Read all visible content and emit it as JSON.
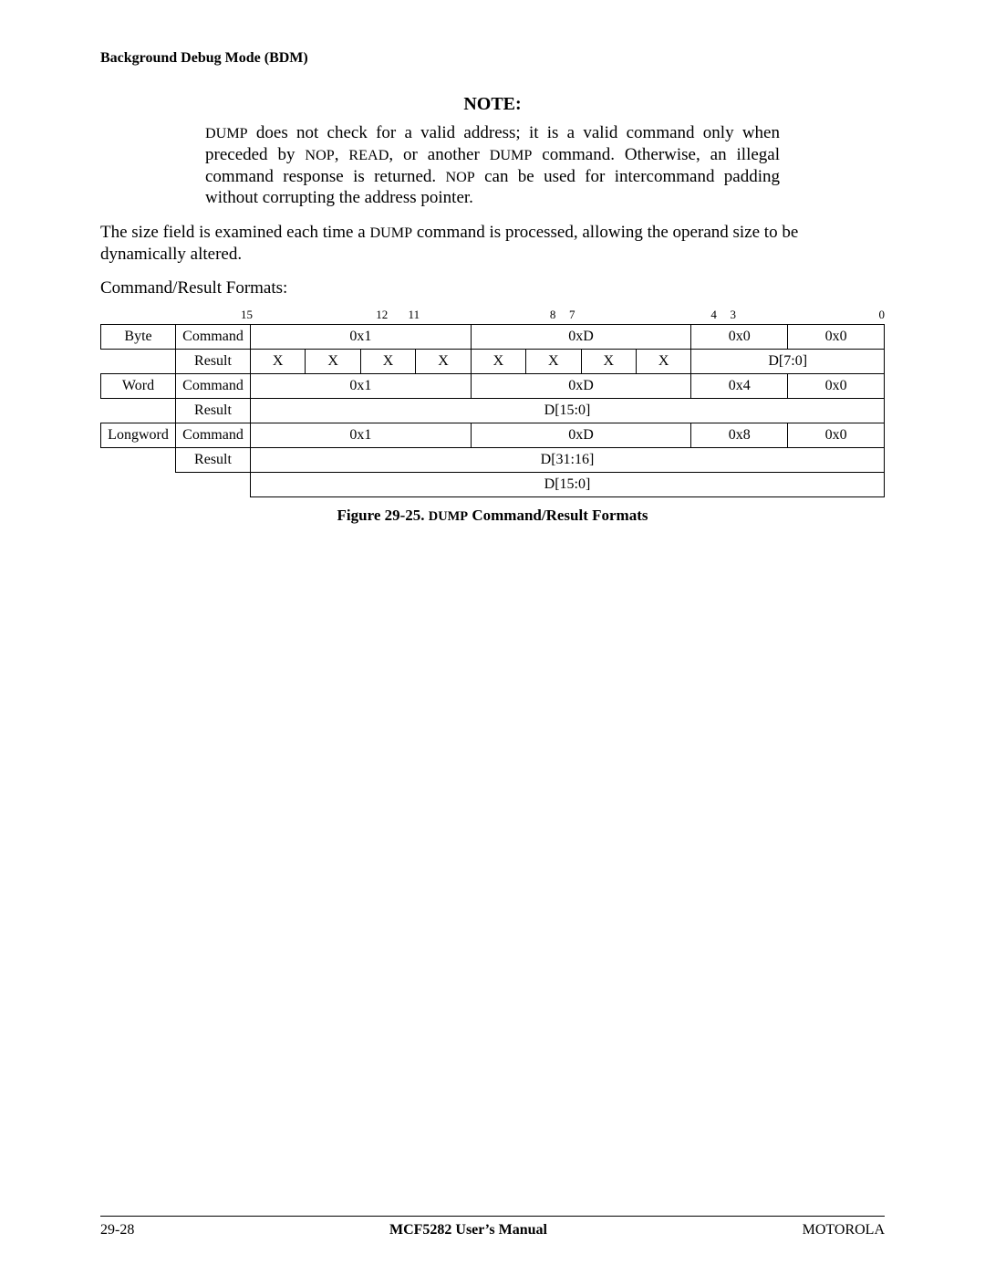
{
  "header": {
    "section_title": "Background Debug Mode (BDM)"
  },
  "note": {
    "heading": "NOTE:",
    "body_parts": [
      "DUMP",
      " does not check for a valid address; it is a valid command only when preceded by ",
      "NOP",
      ", ",
      "READ",
      ", or another ",
      "DUMP",
      " command. Otherwise, an illegal command response is returned. ",
      "NOP",
      " can be used for intercommand padding without corrupting the address pointer."
    ]
  },
  "paragraph": {
    "parts": [
      "The size field is examined each time a ",
      "DUMP",
      " command is processed, allowing the operand size to be dynamically altered."
    ]
  },
  "subheading": "Command/Result Formats:",
  "bit_labels": [
    "15",
    "12",
    "11",
    "8",
    "7",
    "4",
    "3",
    "0"
  ],
  "table": {
    "rows": [
      {
        "type": "Byte",
        "label": "Command",
        "cells": [
          "0x1",
          "0xD",
          "0x0",
          "0x0"
        ],
        "spans": [
          4,
          4,
          4,
          4
        ]
      },
      {
        "type": "",
        "label": "Result",
        "cells": [
          "X",
          "X",
          "X",
          "X",
          "X",
          "X",
          "X",
          "X",
          "D[7:0]"
        ],
        "spans": [
          1,
          1,
          1,
          1,
          1,
          1,
          1,
          1,
          8
        ]
      },
      {
        "type": "Word",
        "label": "Command",
        "cells": [
          "0x1",
          "0xD",
          "0x4",
          "0x0"
        ],
        "spans": [
          4,
          4,
          4,
          4
        ]
      },
      {
        "type": "",
        "label": "Result",
        "cells": [
          "D[15:0]"
        ],
        "spans": [
          16
        ]
      },
      {
        "type": "Longword",
        "label": "Command",
        "cells": [
          "0x1",
          "0xD",
          "0x8",
          "0x0"
        ],
        "spans": [
          4,
          4,
          4,
          4
        ]
      },
      {
        "type": "",
        "label": "Result",
        "cells": [
          "D[31:16]"
        ],
        "spans": [
          16
        ]
      },
      {
        "type": "",
        "label": "",
        "cells": [
          "D[15:0]"
        ],
        "spans": [
          16
        ]
      }
    ]
  },
  "figure_caption": {
    "prefix": "Figure 29-25.  ",
    "dump": "DUMP",
    "suffix": " Command/Result Formats"
  },
  "footer": {
    "left": "29-28",
    "center": "MCF5282 User’s Manual",
    "right": "MOTOROLA"
  }
}
